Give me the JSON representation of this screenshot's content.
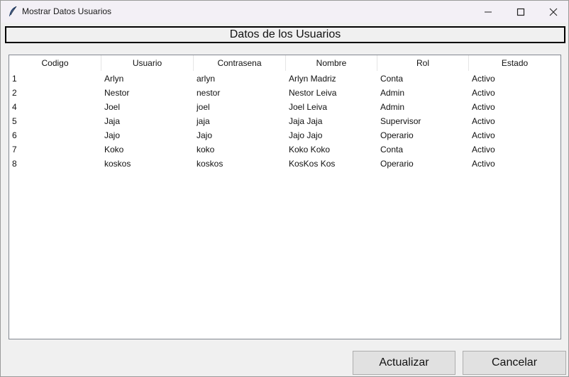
{
  "window": {
    "title": "Mostrar Datos Usuarios"
  },
  "banner": {
    "title": "Datos de los Usuarios"
  },
  "table": {
    "columns": [
      "Codigo",
      "Usuario",
      "Contrasena",
      "Nombre",
      "Rol",
      "Estado"
    ],
    "rows": [
      [
        "1",
        "Arlyn",
        "arlyn",
        "Arlyn Madriz",
        "Conta",
        "Activo"
      ],
      [
        "2",
        "Nestor",
        "nestor",
        "Nestor Leiva",
        "Admin",
        "Activo"
      ],
      [
        "4",
        "Joel",
        "joel",
        "Joel Leiva",
        "Admin",
        "Activo"
      ],
      [
        "5",
        "Jaja",
        "jaja",
        "Jaja Jaja",
        "Supervisor",
        "Activo"
      ],
      [
        "6",
        "Jajo",
        "Jajo",
        "Jajo Jajo",
        "Operario",
        "Activo"
      ],
      [
        "7",
        "Koko",
        "koko",
        "Koko Koko",
        "Conta",
        "Activo"
      ],
      [
        "8",
        "koskos",
        "koskos",
        "KosKos Kos",
        "Operario",
        "Activo"
      ]
    ]
  },
  "buttons": {
    "refresh_label": "Actualizar",
    "cancel_label": "Cancelar"
  }
}
